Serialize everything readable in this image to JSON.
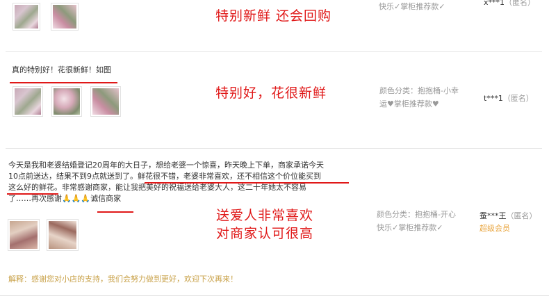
{
  "review1": {
    "annotation": "特别新鲜  还会回购",
    "meta_line1": "快乐✓掌柜推荐款✓",
    "user": "x***1",
    "anon": "（匿名）"
  },
  "review2": {
    "text": "真的特别好！花很新鲜！如图",
    "annotation": "特别好，花很新鲜",
    "meta_label": "颜色分类：",
    "meta_value_line1": "抱抱桶-小幸",
    "meta_value_line2": "运♥掌柜推荐款♥",
    "user": "t***1",
    "anon": "（匿名）"
  },
  "review3": {
    "text_line1": "今天是我和老婆结婚登记20周年的大日子，想给老婆一个惊喜，昨天晚上下单，商家承诺今天",
    "text_line2_a": "10点前送达，结果不到9点就送到了。",
    "text_line2_b": "鲜花很不错，老婆非常喜欢，还不相信这个价位能买到",
    "text_line3_a": "这么好的鲜花。",
    "text_line3_b": "非常感谢商家，能让我把美好的祝福送给老婆大人，这二十年她太不容易",
    "text_line4_a": "了……再次感谢🙏🙏🙏",
    "text_line4_b": "诚信商家",
    "annotation_line1": "送爱人非常喜欢",
    "annotation_line2": "对商家认可很高",
    "meta_label": "颜色分类：",
    "meta_value_line1": "抱抱桶-开心",
    "meta_value_line2": "快乐✓掌柜推荐款✓",
    "user": "蚕***王",
    "anon": "（匿名）",
    "member": "超级会员",
    "reply": "解释：感谢您对小店的支持，我们会努力做到更好，欢迎下次再来！"
  }
}
